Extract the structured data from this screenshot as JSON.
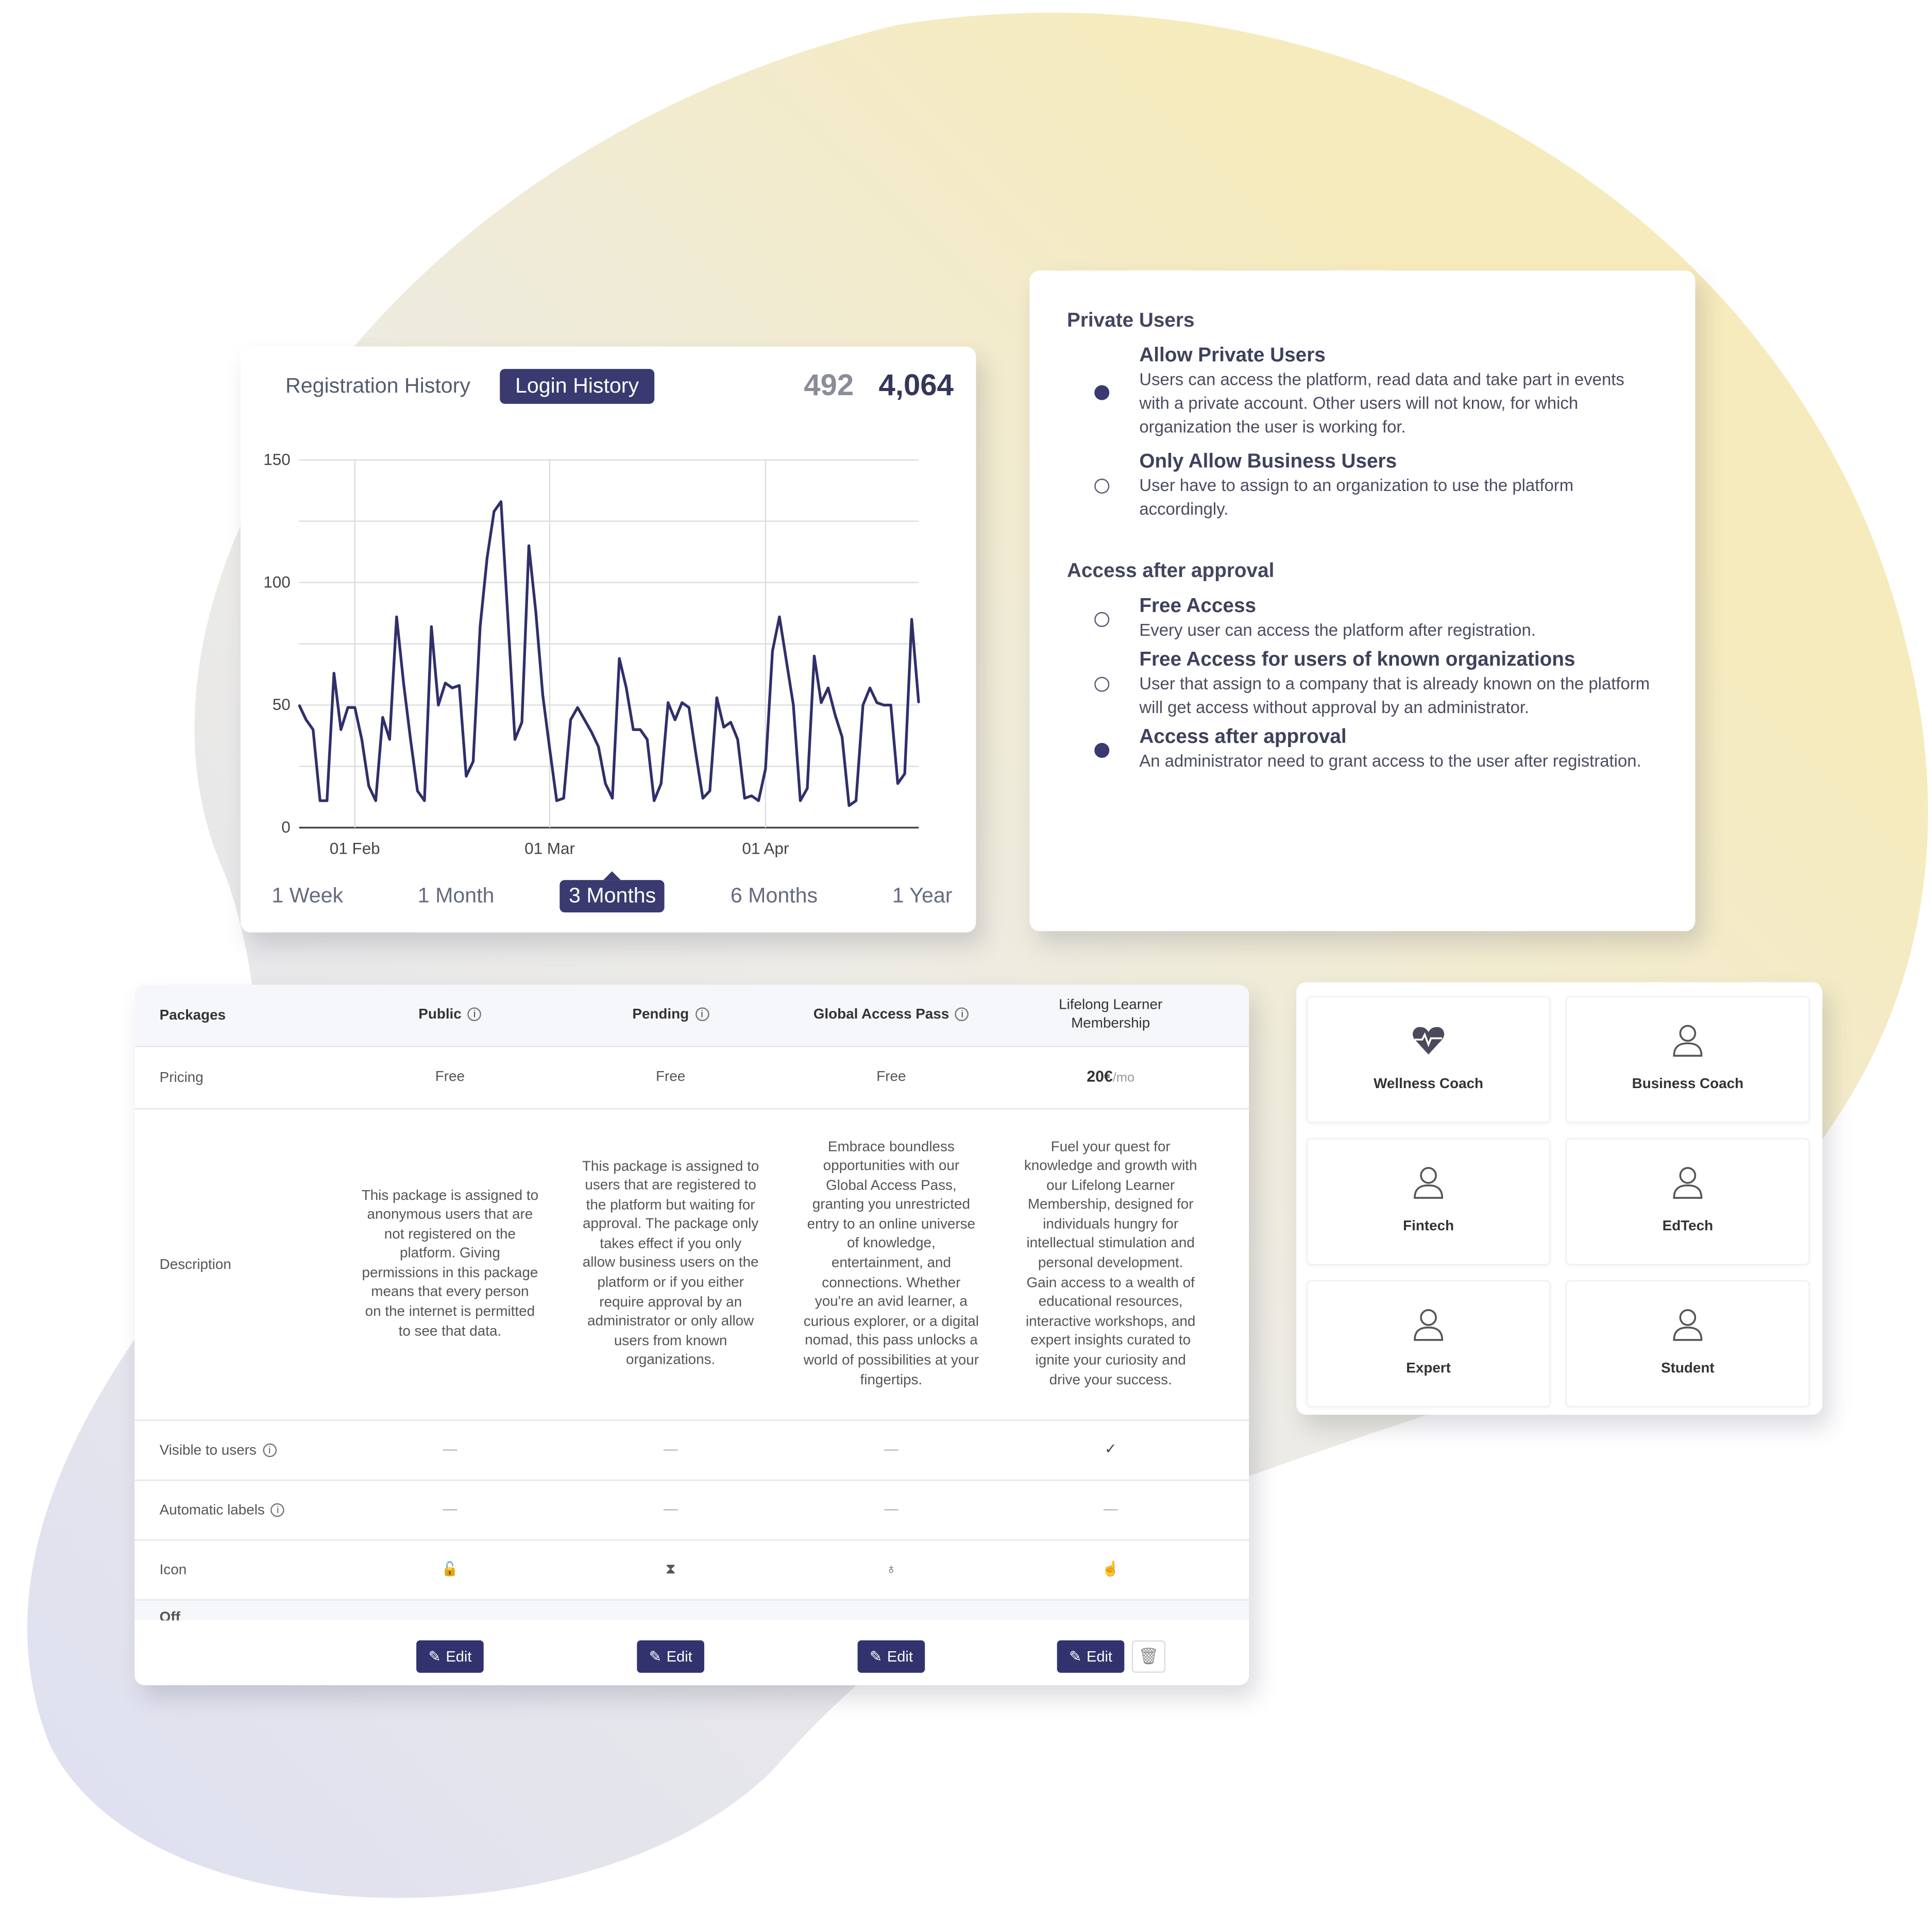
{
  "colors": {
    "accent": "#3a3a70",
    "line": "#2f2f6b",
    "bg_yellow": "#f5ebb8",
    "bg_lavender": "#e3e3f2"
  },
  "chart_card": {
    "tabs": [
      {
        "label": "Registration History",
        "active": false
      },
      {
        "label": "Login History",
        "active": true
      }
    ],
    "total_secondary": "492",
    "total_primary": "4,064",
    "ranges": [
      {
        "label": "1 Week"
      },
      {
        "label": "1 Month"
      },
      {
        "label": "3 Months",
        "active": true
      },
      {
        "label": "6 Months"
      },
      {
        "label": "1 Year"
      }
    ]
  },
  "chart_data": {
    "type": "line",
    "title": "",
    "xlabel": "",
    "ylabel": "",
    "ylim": [
      0,
      150
    ],
    "grid": true,
    "yticks": [
      "0",
      "50",
      "100",
      "150"
    ],
    "xticks": [
      {
        "label": "01 Feb",
        "date": "Feb 1"
      },
      {
        "label": "01 Mar",
        "date": "Mar 1"
      },
      {
        "label": "01 Apr",
        "date": "Apr 1"
      }
    ],
    "x": [
      "Jan 24",
      "Jan 25",
      "Jan 26",
      "Jan 27",
      "Jan 28",
      "Jan 29",
      "Jan 30",
      "Jan 31",
      "Feb 1",
      "Feb 2",
      "Feb 3",
      "Feb 4",
      "Feb 5",
      "Feb 6",
      "Feb 7",
      "Feb 8",
      "Feb 9",
      "Feb 10",
      "Feb 11",
      "Feb 12",
      "Feb 13",
      "Feb 14",
      "Feb 15",
      "Feb 16",
      "Feb 17",
      "Feb 18",
      "Feb 19",
      "Feb 20",
      "Feb 21",
      "Feb 22",
      "Feb 23",
      "Feb 24",
      "Feb 25",
      "Feb 26",
      "Feb 27",
      "Feb 28",
      "Mar 1",
      "Mar 2",
      "Mar 3",
      "Mar 4",
      "Mar 5",
      "Mar 6",
      "Mar 7",
      "Mar 8",
      "Mar 9",
      "Mar 10",
      "Mar 11",
      "Mar 12",
      "Mar 13",
      "Mar 14",
      "Mar 15",
      "Mar 16",
      "Mar 17",
      "Mar 18",
      "Mar 19",
      "Mar 20",
      "Mar 21",
      "Mar 22",
      "Mar 23",
      "Mar 24",
      "Mar 25",
      "Mar 26",
      "Mar 27",
      "Mar 28",
      "Mar 29",
      "Mar 30",
      "Mar 31",
      "Apr 1",
      "Apr 2",
      "Apr 3",
      "Apr 4",
      "Apr 5",
      "Apr 6",
      "Apr 7",
      "Apr 8",
      "Apr 9",
      "Apr 10",
      "Apr 11",
      "Apr 12",
      "Apr 13",
      "Apr 14",
      "Apr 15",
      "Apr 16",
      "Apr 17",
      "Apr 18",
      "Apr 19",
      "Apr 20",
      "Apr 21",
      "Apr 22",
      "Apr 23"
    ],
    "series": [
      {
        "values": [
          50,
          44,
          40,
          11,
          11,
          63,
          40,
          49,
          49,
          36,
          17,
          11,
          45,
          36,
          86,
          59,
          36,
          15,
          11,
          82,
          50,
          59,
          57,
          58,
          21,
          27,
          82,
          110,
          129,
          133,
          85,
          36,
          43,
          115,
          88,
          54,
          32,
          11,
          12,
          44,
          49,
          44,
          39,
          33,
          18,
          12,
          69,
          57,
          40,
          40,
          36,
          11,
          18,
          51,
          44,
          51,
          49,
          30,
          12,
          15,
          53,
          41,
          43,
          36,
          12,
          13,
          11,
          24,
          72,
          86,
          68,
          50,
          11,
          16,
          70,
          51,
          57,
          46,
          37,
          9,
          11,
          50,
          57,
          51,
          50,
          50,
          18,
          22,
          85,
          51
        ]
      }
    ]
  },
  "private_users": {
    "title": "Private Users",
    "options": [
      {
        "title": "Allow Private Users",
        "text": "Users can access the platform, read data and take part in events with a private account. Other users will not know, for which organization the user is working for.",
        "selected": true
      },
      {
        "title": "Only Allow Business Users",
        "text": "User have to assign to an organization to use the platform accordingly.",
        "selected": false
      }
    ]
  },
  "access": {
    "title": "Access after approval",
    "options": [
      {
        "title": "Free Access",
        "text": "Every user can access the platform after registration.",
        "selected": false
      },
      {
        "title": "Free Access for users of known organizations",
        "text": "User that assign to a company that is already known on the platform will get access without approval by an administrator.",
        "selected": false
      },
      {
        "title": "Access after approval",
        "text": "An administrator need to grant access to the user after registration.",
        "selected": true
      }
    ]
  },
  "packages": {
    "header": "Packages",
    "columns": [
      {
        "name": "Public",
        "info": "ⓘ",
        "price": "Free",
        "price_unit": "",
        "desc": "This package is assigned to anonymous users that are not registered on the platform. Giving permissions in this package means that every person on the internet is permitted to see that data.",
        "visible": "—",
        "auto": "—",
        "icon": "🔓",
        "icon_name": "lock-open-icon",
        "edit": "Edit"
      },
      {
        "name": "Pending",
        "info": "ⓘ",
        "price": "Free",
        "price_unit": "",
        "desc": "This package is assigned to users that are registered to the platform but waiting for approval. The package only takes effect if you only allow business users on the platform or if you either require approval by an administrator or only allow users from known organizations.",
        "visible": "—",
        "auto": "—",
        "icon": "⧗",
        "icon_name": "hourglass-icon",
        "edit": "Edit"
      },
      {
        "name": "Global Access Pass",
        "info": "ⓘ",
        "price": "Free",
        "price_unit": "",
        "desc": "Embrace boundless opportunities with our Global Access Pass, granting you unrestricted entry to an online universe of knowledge, entertainment, and connections. Whether you're an avid learner, a curious explorer, or a digital nomad, this pass unlocks a world of possibilities at your fingertips.",
        "visible": "—",
        "auto": "—",
        "icon": "♁",
        "icon_name": "apple-icon",
        "edit": "Edit"
      },
      {
        "name": "Lifelong Learner Membership",
        "info": "",
        "price": "20€",
        "price_unit": "/mo",
        "desc": "Fuel your quest for knowledge and growth with our Lifelong Learner Membership, designed for individuals hungry for intellectual stimulation and personal development. Gain access to a wealth of educational resources, interactive workshops, and expert insights curated to ignite your curiosity and drive your success.",
        "visible": "✓",
        "auto": "—",
        "icon": "☝",
        "icon_name": "hand-icon",
        "edit": "Edit"
      }
    ],
    "rows": {
      "pricing": "Pricing",
      "description": "Description",
      "visible": "Visible to users",
      "auto": "Automatic labels",
      "icon": "Icon",
      "partial": "Off"
    }
  },
  "profiles": [
    {
      "name": "Wellness Coach",
      "icon": "heart-pulse-icon"
    },
    {
      "name": "Business Coach",
      "icon": "user-icon"
    },
    {
      "name": "Fintech",
      "icon": "user-icon"
    },
    {
      "name": "EdTech",
      "icon": "user-icon"
    },
    {
      "name": "Expert",
      "icon": "user-icon"
    },
    {
      "name": "Student",
      "icon": "user-icon"
    }
  ]
}
